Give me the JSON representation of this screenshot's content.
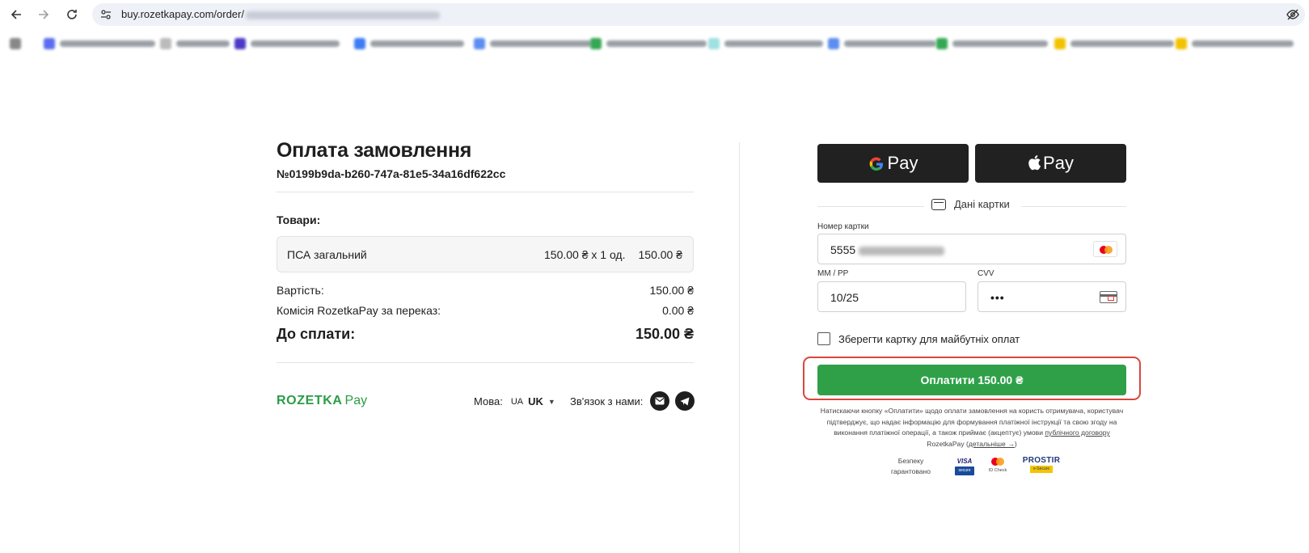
{
  "browser": {
    "url_visible": "buy.rozetkapay.com/order/"
  },
  "order": {
    "title": "Оплата замовлення",
    "number": "№0199b9da-b260-747a-81e5-34a16df622cc",
    "goods_label": "Товари:",
    "item": {
      "name": "ПСА загальний",
      "unit_price_qty": "150.00 ₴ x 1 од.",
      "total": "150.00 ₴"
    },
    "summary": [
      {
        "label": "Вартість:",
        "value": "150.00 ₴"
      },
      {
        "label": "Комісія RozetkaPay за переказ:",
        "value": "0.00 ₴"
      }
    ],
    "total_label": "До сплати:",
    "total_value": "150.00 ₴"
  },
  "footer": {
    "brand_main": "ROZETKA",
    "brand_pay": "Pay",
    "language_label": "Мова:",
    "language_flag": "UA",
    "language_code": "UK",
    "contact_label": "Зв'язок з нами:",
    "icons": [
      "mail-icon",
      "telegram-icon"
    ]
  },
  "payment": {
    "gpay_label": "Pay",
    "gpay_g": "G",
    "applepay_label": "Pay",
    "card_section_title": "Дані картки",
    "card_number_label": "Номер картки",
    "card_number_value": "5555",
    "expiry_label": "MM / PP",
    "expiry_value": "10/25",
    "cvv_label": "CVV",
    "cvv_value": "•••",
    "save_card_label": "Зберегти картку для майбутніх оплат",
    "save_card_checked": false,
    "pay_button_label": "Оплатити 150.00 ₴",
    "disclaimer_main": "Натискаючи кнопку «Оплатити» щодо оплати замовлення на користь отримувача, користувач підтверджує, що надає інформацію для формування платіжної інструкції та свою згоду на виконання платіжної операції, а також приймає (акцептує) умови",
    "disclaimer_link": "публічного договору",
    "disclaimer_mid": "RozetkaPay (",
    "disclaimer_more": "детальніше →",
    "disclaimer_end": ")",
    "secure_text": "Безпеку гарантовано",
    "visa_label": "VISA",
    "visa_sub": "secure",
    "idcheck_label": "ID Check",
    "prostir_label": "PROSTIR",
    "prostir_sub": "e-Secure"
  },
  "colors": {
    "accent_green": "#2fa048",
    "brand_green": "#2a9d46",
    "dark_button": "#212121",
    "highlight_red": "#d9473b"
  }
}
